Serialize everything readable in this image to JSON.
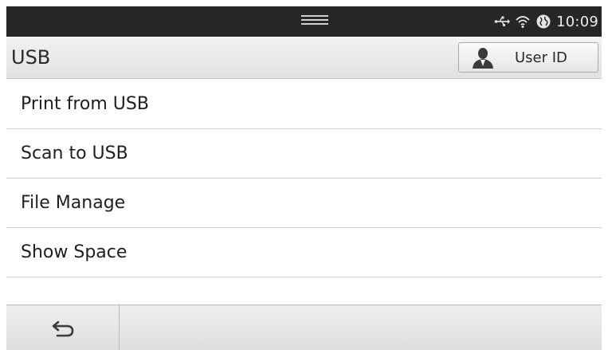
{
  "statusbar": {
    "time": "10:09",
    "icons": [
      "usb-icon",
      "wifi-icon",
      "globe-icon"
    ]
  },
  "titlebar": {
    "title": "USB",
    "user_button_label": "User ID",
    "user_button_icon": "user-icon"
  },
  "menu": {
    "items": [
      {
        "label": "Print from USB"
      },
      {
        "label": "Scan to USB"
      },
      {
        "label": "File Manage"
      },
      {
        "label": "Show Space"
      }
    ]
  },
  "bottombar": {
    "back_icon": "back-arrow-icon"
  }
}
